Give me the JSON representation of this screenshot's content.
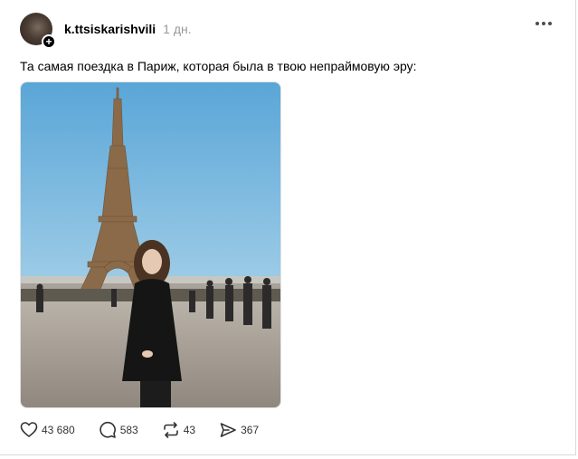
{
  "post": {
    "author": "k.ttsiskarishvili",
    "time": "1 дн.",
    "text": "Та самая поездка в Париж, которая была в твою непраймовую эру:",
    "follow_symbol": "+"
  },
  "actions": {
    "likes": "43 680",
    "comments": "583",
    "reposts": "43",
    "shares": "367"
  },
  "icons": {
    "avatar_plus": "plus-icon",
    "more": "more-icon",
    "like": "heart-icon",
    "comment": "comment-icon",
    "repost": "repost-icon",
    "share": "send-icon"
  },
  "colors": {
    "text": "#000000",
    "muted": "#999999",
    "icon": "#333333"
  }
}
